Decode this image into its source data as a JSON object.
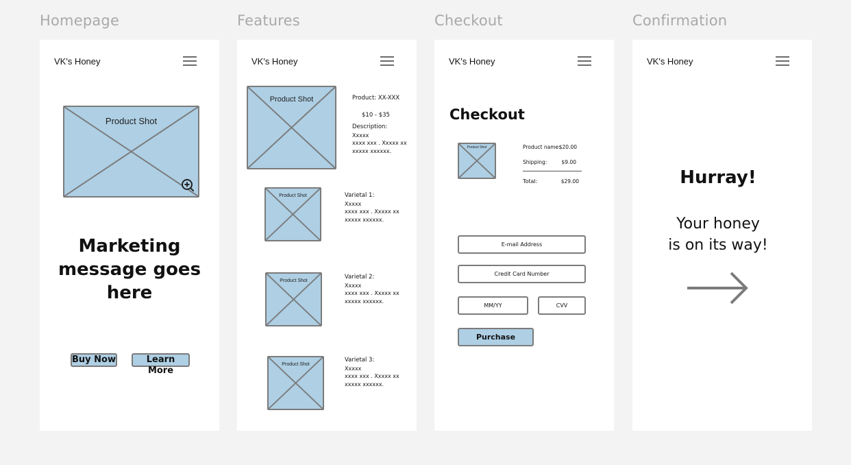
{
  "frames": {
    "homepage": "Homepage",
    "features": "Features",
    "checkout": "Checkout",
    "confirmation": "Confirmation"
  },
  "brand": "VK's Honey",
  "home": {
    "product_shot_label": "Product Shot",
    "marketing_line1": "Marketing",
    "marketing_line2": "message goes",
    "marketing_line3": "here",
    "buy_now": "Buy Now",
    "learn_more": "Learn More"
  },
  "features": {
    "main_shot_label": "Product Shot",
    "product_line": "Product: XX-XXX",
    "price_range": "$10 - $35",
    "description_label": "Description:",
    "description_lines": [
      "Xxxxx",
      "xxxx xxx . Xxxxx xx",
      "xxxxx xxxxxx."
    ],
    "varietals": [
      {
        "shot_label": "Product Shot",
        "title": "Varietal 1:",
        "lines": [
          "Xxxxx",
          "xxxx xxx . Xxxxx xx",
          "xxxxx xxxxxx."
        ]
      },
      {
        "shot_label": "Product Shot",
        "title": "Varietal 2:",
        "lines": [
          "Xxxxx",
          "xxxx xxx . Xxxxx xx",
          "xxxxx xxxxxx."
        ]
      },
      {
        "shot_label": "Product Shot",
        "title": "Varietal 3:",
        "lines": [
          "Xxxxx",
          "xxxx xxx . Xxxxx xx",
          "xxxxx xxxxxx."
        ]
      }
    ]
  },
  "checkout": {
    "title": "Checkout",
    "thumb_label": "Product Shot",
    "product_name_label": "Product name:",
    "product_name_value": "$20.00",
    "shipping_label": "Shipping:",
    "shipping_value": "$9.00",
    "total_label": "Total:",
    "total_value": "$29.00",
    "email_placeholder": "E-mail Address",
    "card_placeholder": "Credit Card Number",
    "expiry_placeholder": "MM/YY",
    "cvv_placeholder": "CVV",
    "purchase": "Purchase"
  },
  "confirmation": {
    "headline": "Hurray!",
    "line1": "Your honey",
    "line2": "is on its way!",
    "arrow_icon": "right-arrow-icon"
  },
  "colors": {
    "page_bg": "#f3f3f3",
    "placeholder_fill": "#aecfe4",
    "stroke": "#7b7b7b",
    "label": "#a9a9a9"
  }
}
